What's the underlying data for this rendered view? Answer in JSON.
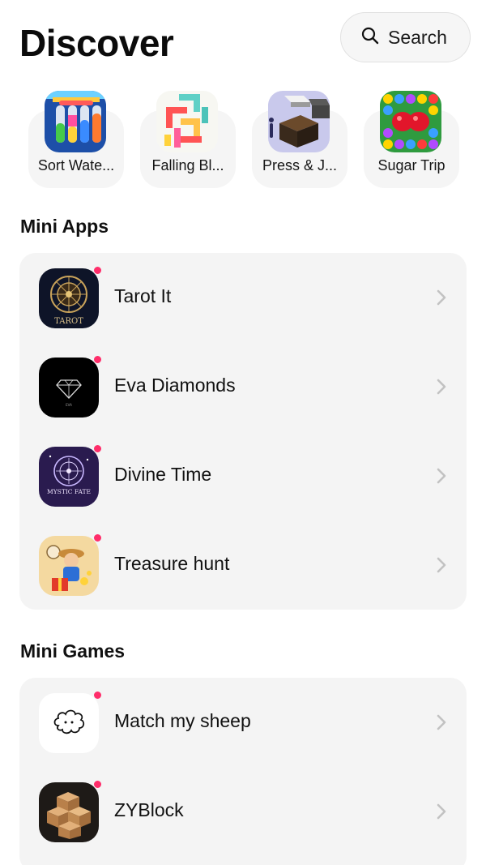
{
  "header": {
    "title": "Discover",
    "search_label": "Search"
  },
  "recent": [
    {
      "label": "Sort Wate...",
      "icon": "sort-water-icon"
    },
    {
      "label": "Falling Bl...",
      "icon": "falling-blocks-icon"
    },
    {
      "label": "Press & J...",
      "icon": "press-jump-icon"
    },
    {
      "label": "Sugar Trip",
      "icon": "sugar-trip-icon"
    }
  ],
  "mini_apps": {
    "title": "Mini Apps",
    "items": [
      {
        "name": "Tarot It",
        "icon": "tarot-icon",
        "icon_text": "TAROT",
        "badge": true
      },
      {
        "name": "Eva Diamonds",
        "icon": "diamond-icon",
        "icon_text": "EVA",
        "badge": true
      },
      {
        "name": "Divine Time",
        "icon": "mystic-fate-icon",
        "icon_text": "MYSTIC FATE",
        "badge": true
      },
      {
        "name": "Treasure hunt",
        "icon": "treasure-hunt-icon",
        "badge": true
      }
    ]
  },
  "mini_games": {
    "title": "Mini Games",
    "items": [
      {
        "name": "Match my sheep",
        "icon": "sheep-icon",
        "badge": true
      },
      {
        "name": "ZYBlock",
        "icon": "zyblock-icon",
        "badge": true
      }
    ]
  },
  "colors": {
    "badge": "#ff2d6a",
    "card_bg": "#f4f4f4",
    "search_bg": "#f6f6f6"
  }
}
